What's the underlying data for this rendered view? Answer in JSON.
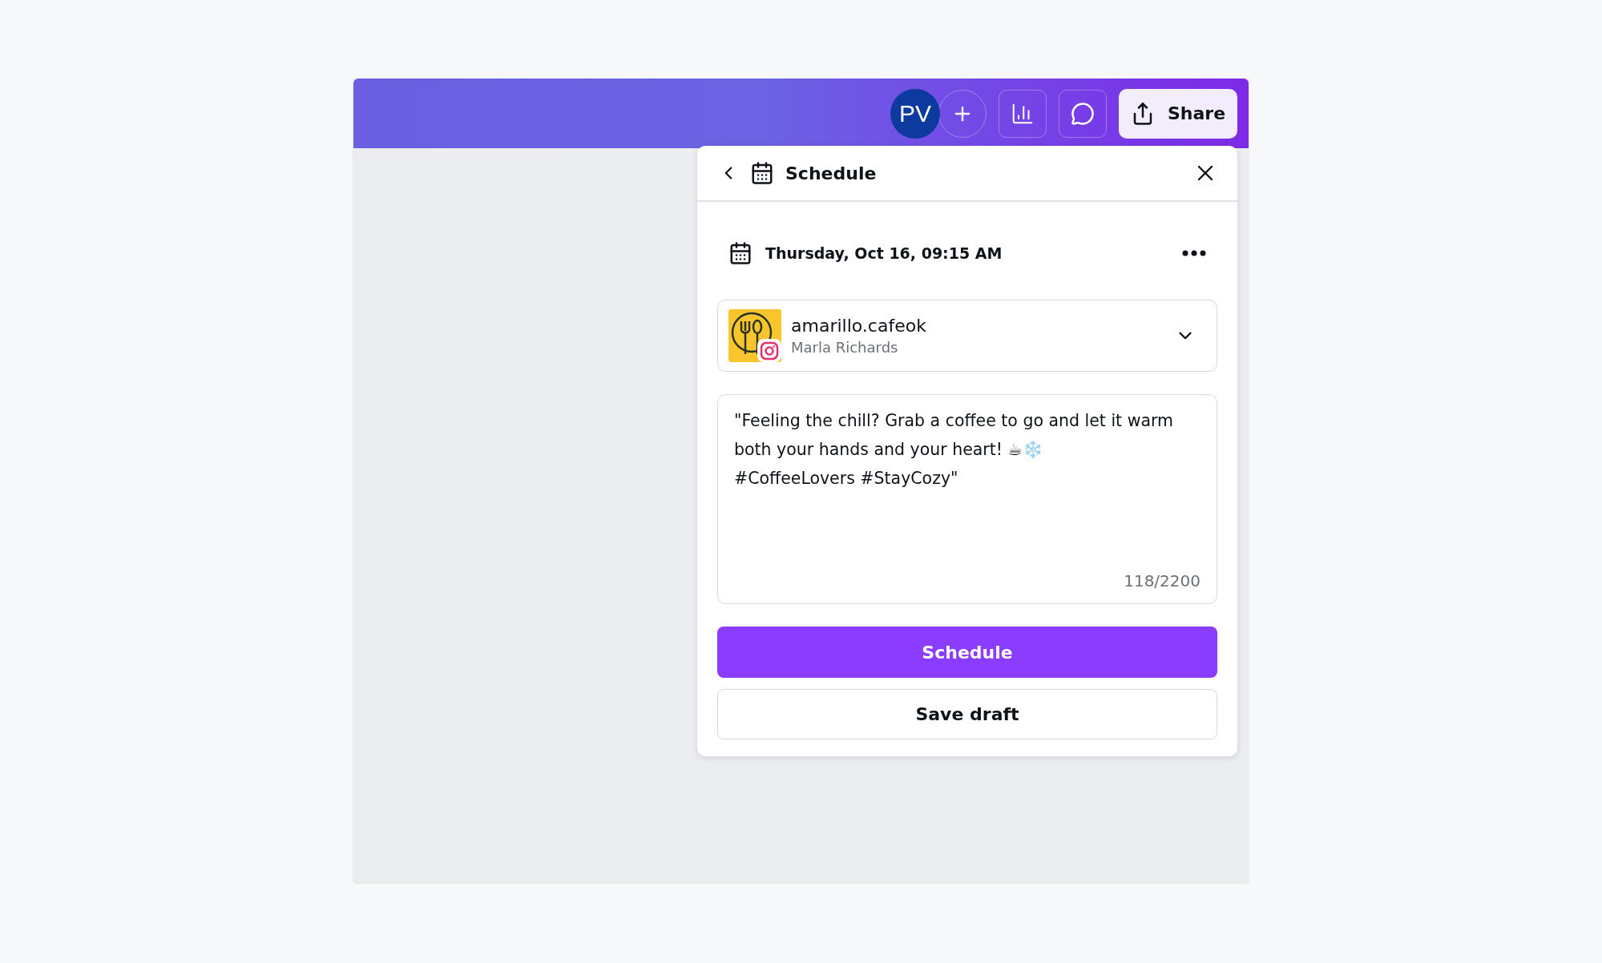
{
  "topbar": {
    "avatar": "PV",
    "share": "Share"
  },
  "panel": {
    "title": "Schedule",
    "datetime": "Thursday, Oct 16, 09:15 AM",
    "account": {
      "name": "amarillo.cafeok",
      "owner": "Marla Richards"
    },
    "caption": "\"Feeling the chill? Grab a coffee to go and let it warm both your hands and your heart! ☕❄️\n#CoffeeLovers #StayCozy\"",
    "counter": "118/2200",
    "primary_button": "Schedule",
    "secondary_button": "Save draft"
  }
}
